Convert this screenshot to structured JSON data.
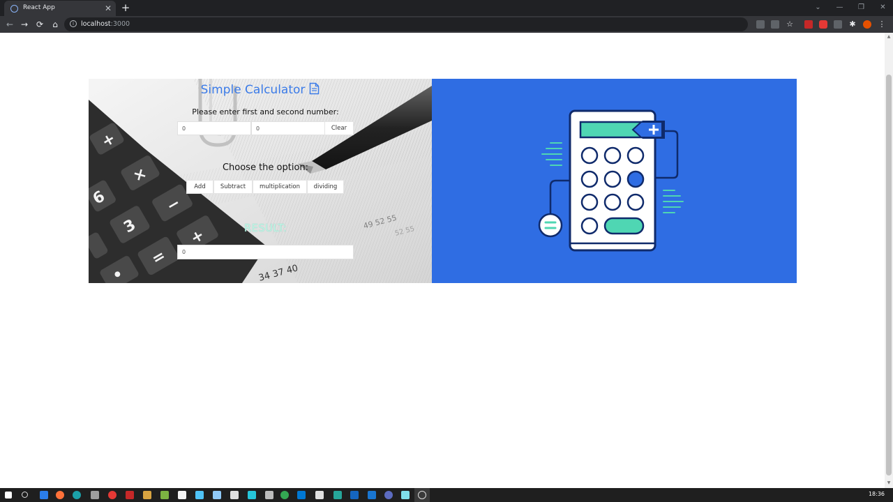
{
  "browser": {
    "tab_title": "React App",
    "tab_close": "✕",
    "new_tab": "+",
    "host": "localhost",
    "port": ":3000",
    "win_controls": {
      "chevron": "⌄",
      "minimize": "—",
      "restore": "❐",
      "close": "✕"
    },
    "nav": {
      "back": "←",
      "forward": "→",
      "reload": "⟳",
      "home": "⌂"
    },
    "toolbar_icons": [
      "translate-icon",
      "share-icon",
      "star-icon",
      "extension-red-icon",
      "adblock-icon",
      "extensions-icon",
      "profile-icon",
      "menu-icon"
    ],
    "menu": "⋮"
  },
  "calculator": {
    "title": "Simple Calculator",
    "prompt": "Please enter first and second number:",
    "first_value": "0",
    "second_value": "0",
    "clear_label": "Clear",
    "choose_label": "Choose the option:",
    "ops": {
      "add": "Add",
      "subtract": "Subtract",
      "multiply": "multiplication",
      "divide": "dividing"
    },
    "result_label": "RESULT:",
    "result_value": "0"
  },
  "illustration": {
    "background": "#2f6de3",
    "accent": "#4fd6b3",
    "outline": "#0f2a6b"
  },
  "taskbar": {
    "clock": "18:36"
  }
}
